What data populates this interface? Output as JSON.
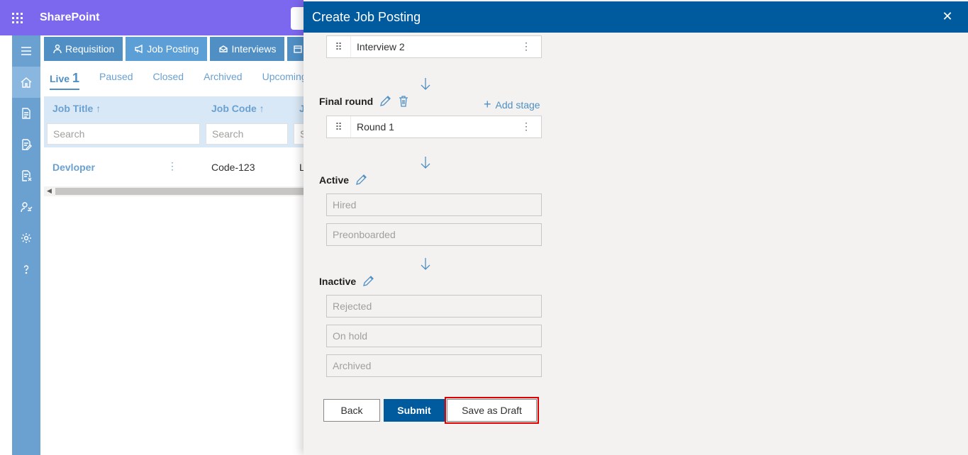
{
  "suitebar": {
    "app_name": "SharePoint"
  },
  "nav_tabs": [
    {
      "label": "Requisition",
      "icon": "person-icon"
    },
    {
      "label": "Job Posting",
      "icon": "megaphone-icon"
    },
    {
      "label": "Interviews",
      "icon": "interview-icon"
    }
  ],
  "status_tabs": {
    "live": "Live",
    "live_count": "1",
    "paused": "Paused",
    "closed": "Closed",
    "archived": "Archived",
    "upcoming": "Upcoming"
  },
  "grid": {
    "col_job_title": "Job Title ↑",
    "col_job_code": "Job Code ↑",
    "col_third": "J",
    "search_placeholder": "Search",
    "search_third": "S",
    "row": {
      "title": "Devloper",
      "more": "⋮",
      "code": "Code-123",
      "loc": "L"
    }
  },
  "panel": {
    "title": "Create Job Posting",
    "close": "✕",
    "interview2": "Interview 2",
    "final_round": "Final round",
    "add_stage": "Add stage",
    "round1": "Round 1",
    "active": "Active",
    "hired": "Hired",
    "preonboarded": "Preonboarded",
    "inactive": "Inactive",
    "rejected": "Rejected",
    "on_hold": "On hold",
    "archived": "Archived",
    "back": "Back",
    "submit": "Submit",
    "save_draft": "Save as Draft"
  },
  "colors": {
    "suitebar": "#7b68ee",
    "panel_header": "#005a9e",
    "accent": "#4f8fc4",
    "highlight": "#e00000"
  }
}
